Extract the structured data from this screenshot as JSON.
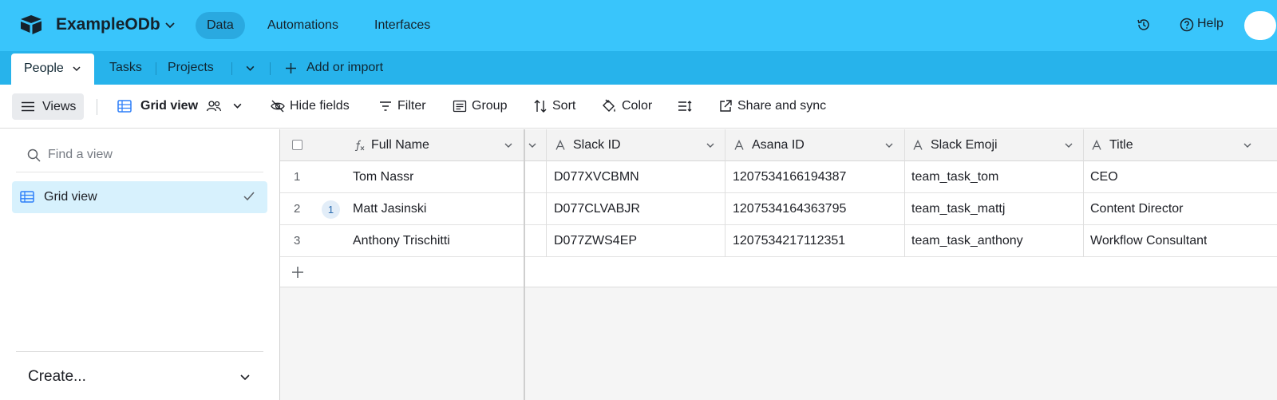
{
  "header": {
    "base_name": "ExampleODb",
    "nav": [
      "Data",
      "Automations",
      "Interfaces"
    ],
    "help_label": "Help"
  },
  "tabs": {
    "items": [
      "People",
      "Tasks",
      "Projects"
    ],
    "add_label": "Add or import"
  },
  "toolbar": {
    "views_label": "Views",
    "view_name": "Grid view",
    "hide_fields": "Hide fields",
    "filter": "Filter",
    "group": "Group",
    "sort": "Sort",
    "color": "Color",
    "share": "Share and sync"
  },
  "sidebar": {
    "find_placeholder": "Find a view",
    "views": [
      {
        "label": "Grid view",
        "selected": true
      }
    ],
    "create_label": "Create..."
  },
  "grid": {
    "columns": [
      "Full Name",
      "Slack ID",
      "Asana ID",
      "Slack Emoji",
      "Title"
    ],
    "rows": [
      {
        "num": "1",
        "full_name": "Tom Nassr",
        "slack_id": "D077XVCBMN",
        "asana_id": "1207534166194387",
        "slack_emoji": "team_task_tom",
        "title": "CEO",
        "comments": ""
      },
      {
        "num": "2",
        "full_name": "Matt Jasinski",
        "slack_id": "D077CLVABJR",
        "asana_id": "1207534164363795",
        "slack_emoji": "team_task_mattj",
        "title": "Content Director",
        "comments": "1"
      },
      {
        "num": "3",
        "full_name": "Anthony Trischitti",
        "slack_id": "D077ZWS4EP",
        "asana_id": "1207534217112351",
        "slack_emoji": "team_task_anthony",
        "title": "Workflow Consultant",
        "comments": ""
      }
    ]
  },
  "colors": {
    "header_bg": "#39c5fb",
    "tabbar_bg": "#27b3eb",
    "selected_view_bg": "#d7f1fd"
  }
}
